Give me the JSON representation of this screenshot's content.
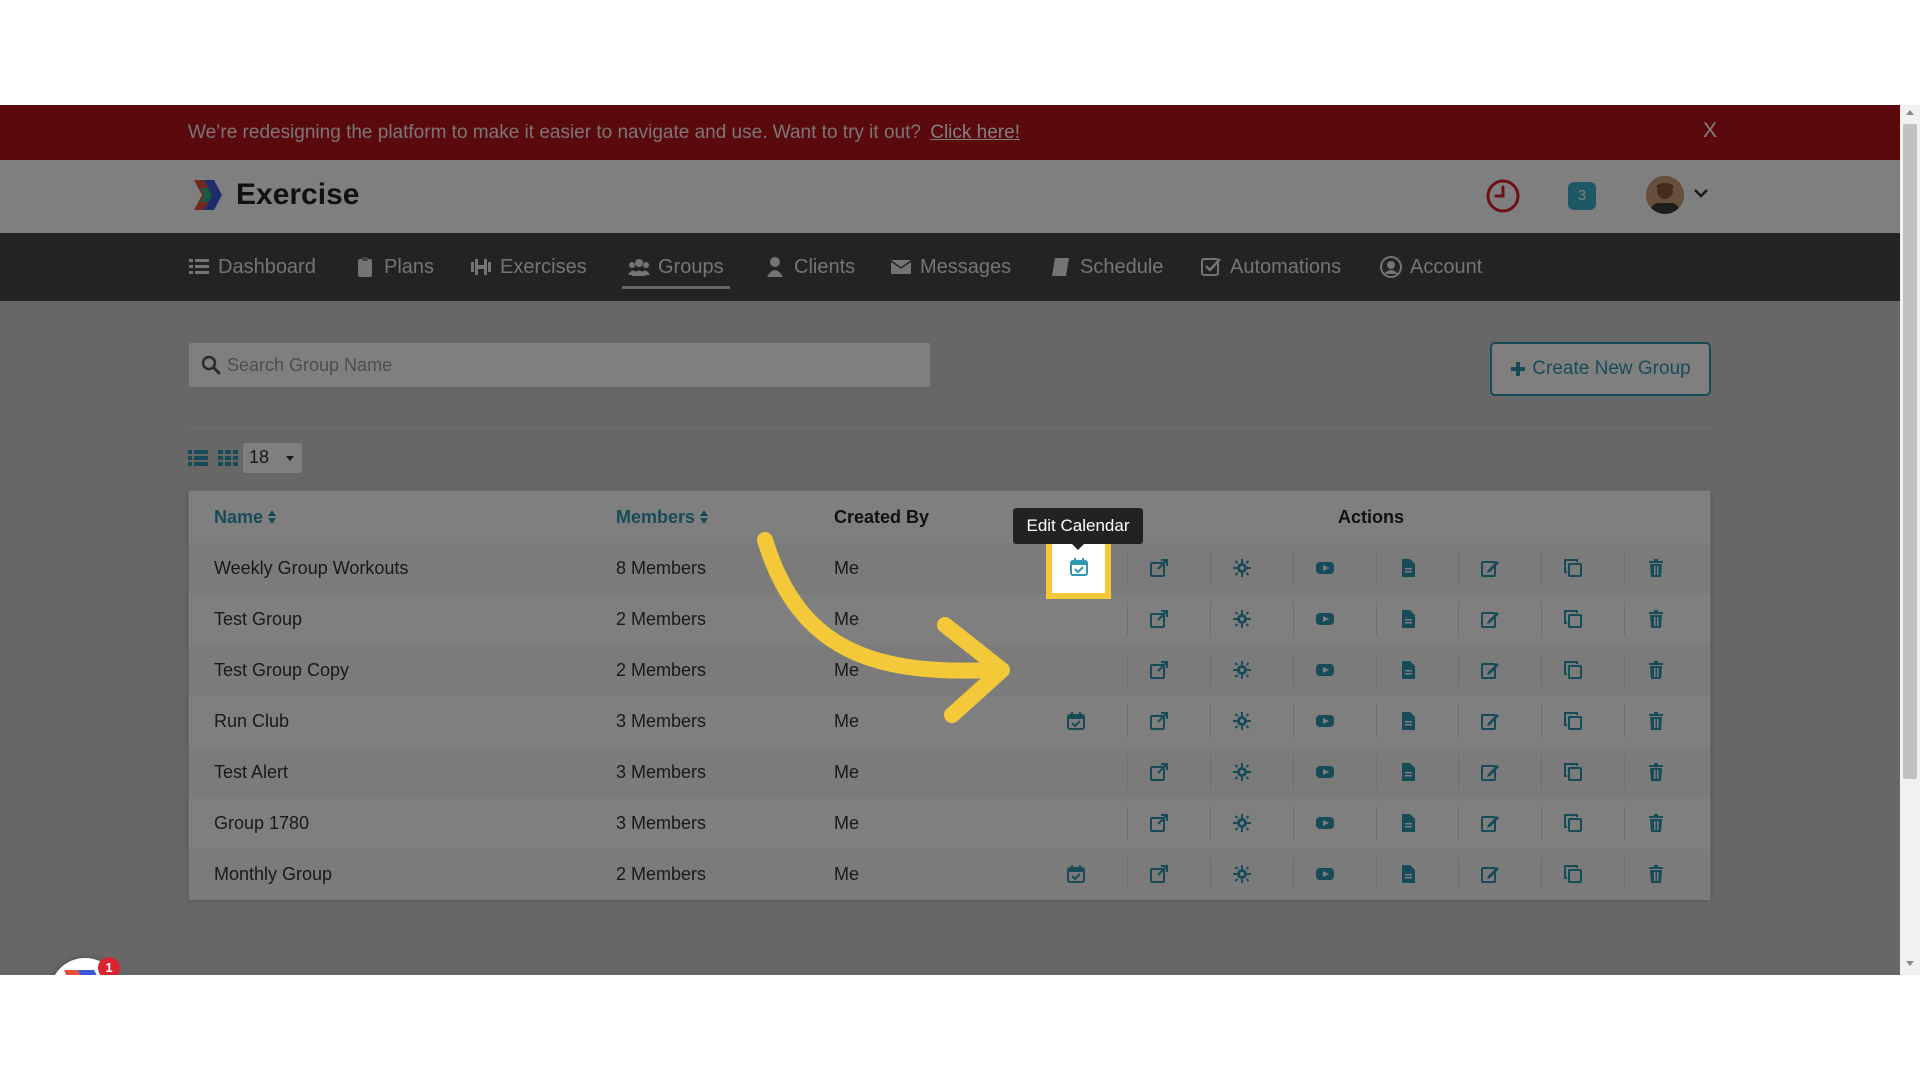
{
  "banner": {
    "message": "We’re redesigning the platform to make it easier to navigate and use. Want to try it out?",
    "link_label": "Click here!",
    "close_label": "X"
  },
  "header": {
    "brand": "Exercise",
    "notification_count": "3",
    "accent_color": "#2f97b0",
    "banner_color": "#b5121a"
  },
  "nav": {
    "items": [
      {
        "label": "Dashboard",
        "icon": "list-icon"
      },
      {
        "label": "Plans",
        "icon": "clipboard-icon"
      },
      {
        "label": "Exercises",
        "icon": "dumbbell-icon"
      },
      {
        "label": "Groups",
        "icon": "users-icon",
        "active": true
      },
      {
        "label": "Clients",
        "icon": "user-icon"
      },
      {
        "label": "Messages",
        "icon": "envelope-icon"
      },
      {
        "label": "Schedule",
        "icon": "book-icon"
      },
      {
        "label": "Automations",
        "icon": "check-square-icon"
      },
      {
        "label": "Account",
        "icon": "user-circle-icon"
      }
    ]
  },
  "toolbar": {
    "search_placeholder": "Search Group Name",
    "create_label": "Create New Group",
    "per_page": "18"
  },
  "table": {
    "headers": {
      "name": "Name",
      "members": "Members",
      "created_by": "Created By",
      "actions": "Actions"
    },
    "rows": [
      {
        "name": "Weekly Group Workouts",
        "members": "8 Members",
        "created_by": "Me",
        "has_calendar": true
      },
      {
        "name": "Test Group",
        "members": "2 Members",
        "created_by": "Me",
        "has_calendar": false
      },
      {
        "name": "Test Group Copy",
        "members": "2 Members",
        "created_by": "Me",
        "has_calendar": false
      },
      {
        "name": "Run Club",
        "members": "3 Members",
        "created_by": "Me",
        "has_calendar": true
      },
      {
        "name": "Test Alert",
        "members": "3 Members",
        "created_by": "Me",
        "has_calendar": false
      },
      {
        "name": "Group 1780",
        "members": "3 Members",
        "created_by": "Me",
        "has_calendar": false
      },
      {
        "name": "Monthly Group",
        "members": "2 Members",
        "created_by": "Me",
        "has_calendar": true
      }
    ]
  },
  "tooltip": {
    "label": "Edit Calendar"
  },
  "launcher": {
    "badge_count": "1"
  }
}
